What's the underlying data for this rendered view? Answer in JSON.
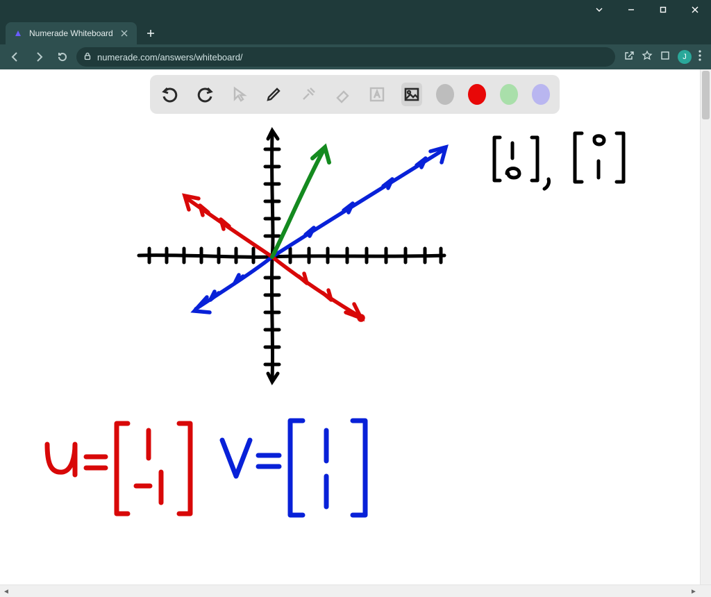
{
  "window": {
    "app": "Chrome"
  },
  "tab": {
    "title": "Numerade Whiteboard"
  },
  "url": {
    "text": "numerade.com/answers/whiteboard/"
  },
  "avatar": {
    "initial": "J"
  },
  "toolbar": {
    "tools": {
      "undo": "undo",
      "redo": "redo",
      "pointer": "pointer",
      "pen": "pen",
      "tools": "tools",
      "eraser": "eraser",
      "text": "text",
      "image": "image"
    },
    "colors": {
      "gray": "#bdbdbd",
      "red": "#e80808",
      "green": "#a9dfaa",
      "purple": "#b9b6f0"
    },
    "selected_color": "red",
    "active_tool": "image"
  },
  "whiteboard": {
    "annotations": {
      "top_right_basis": "[1 0], [0 1]",
      "u_label": "u =",
      "u_vector": "[1; -1]",
      "v_label": "v =",
      "v_vector": "[1; 1]"
    },
    "vectors": {
      "u": {
        "color": "red",
        "value": [
          1,
          -1
        ]
      },
      "v": {
        "color": "blue",
        "value": [
          1,
          1
        ]
      },
      "sum": {
        "color": "green"
      }
    }
  }
}
